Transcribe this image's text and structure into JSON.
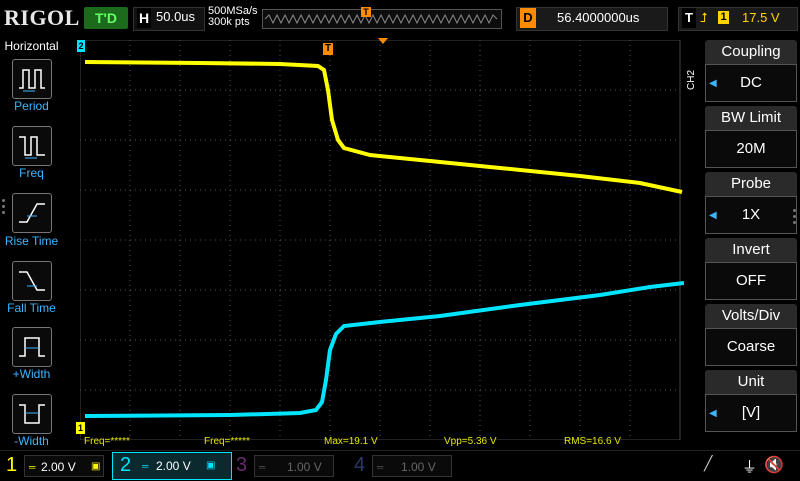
{
  "brand": "RIGOL",
  "top": {
    "run_state": "T'D",
    "timebase_label": "H",
    "timebase_value": "50.0us",
    "sample_rate": "500MSa/s",
    "memory_depth": "300k pts",
    "delay_label": "D",
    "delay_value": "56.4000000us",
    "trigger_label": "T",
    "trigger_source": "1",
    "trigger_level": "17.5 V",
    "trigger_marker": "T"
  },
  "left_panel": {
    "title": "Horizontal",
    "items": [
      {
        "label": "Period",
        "icon": "period-icon"
      },
      {
        "label": "Freq",
        "icon": "frequency-icon"
      },
      {
        "label": "Rise Time",
        "icon": "rise-time-icon"
      },
      {
        "label": "Fall Time",
        "icon": "fall-time-icon"
      },
      {
        "label": "+Width",
        "icon": "positive-width-icon"
      },
      {
        "label": "-Width",
        "icon": "negative-width-icon"
      }
    ]
  },
  "right_panel": {
    "channel_tab": "CH2",
    "menus": [
      {
        "title": "Coupling",
        "value": "DC",
        "arrow": true
      },
      {
        "title": "BW Limit",
        "value": "20M",
        "arrow": false
      },
      {
        "title": "Probe",
        "value": "1X",
        "arrow": true
      },
      {
        "title": "Invert",
        "value": "OFF",
        "arrow": false
      },
      {
        "title": "Volts/Div",
        "value": "Coarse",
        "arrow": false
      },
      {
        "title": "Unit",
        "value": "[V]",
        "arrow": true
      }
    ]
  },
  "measurements": {
    "freq1": "Freq=*****",
    "freq2": "Freq=*****",
    "max": "Max=19.1 V",
    "vpp": "Vpp=5.36 V",
    "rms": "RMS=16.6 V"
  },
  "channels": [
    {
      "num": "1",
      "scale": "2.00 V",
      "color": "#ffff00",
      "active": true
    },
    {
      "num": "2",
      "scale": "2.00 V",
      "color": "#00e5ff",
      "active": true
    },
    {
      "num": "3",
      "scale": "1.00 V",
      "color": "#ff00ff",
      "active": false
    },
    {
      "num": "4",
      "scale": "1.00 V",
      "color": "#3d6bff",
      "active": false
    }
  ],
  "colors": {
    "ch1": "#ffff00",
    "ch2": "#00e5ff",
    "trigger": "#ff8c00",
    "menu_accent": "#3db5ff"
  },
  "markers": {
    "ch1_ground": "1",
    "ch2_ground": "2"
  }
}
